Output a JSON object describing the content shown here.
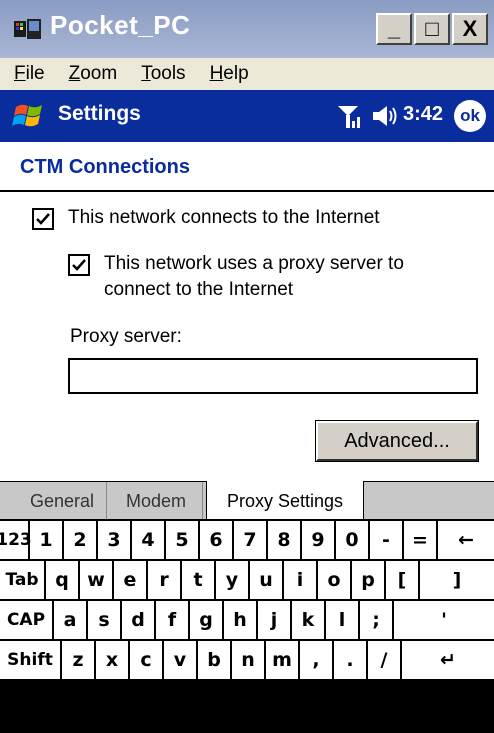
{
  "window": {
    "title": "Pocket_PC",
    "controls": {
      "minimize": "_",
      "maximize": "□",
      "close": "X"
    }
  },
  "menubar": {
    "items": [
      {
        "label_first": "F",
        "label_rest": "ile"
      },
      {
        "label_first": "Z",
        "label_rest": "oom"
      },
      {
        "label_first": "T",
        "label_rest": "ools"
      },
      {
        "label_first": "H",
        "label_rest": "elp"
      }
    ]
  },
  "navbar": {
    "title": "Settings",
    "time": "3:42",
    "ok_label": "ok",
    "icons": [
      "start-flag-icon",
      "signal-icon",
      "speaker-icon"
    ]
  },
  "page": {
    "title": "CTM Connections",
    "checkbox_internet": {
      "label": "This network connects to the Internet",
      "checked": true
    },
    "checkbox_proxy": {
      "label_line1": "This network uses a proxy server to",
      "label_line2": "connect to the Internet",
      "checked": true
    },
    "proxy_server_label": "Proxy server:",
    "proxy_server_value": "",
    "advanced_button": "Advanced..."
  },
  "tabs": [
    {
      "label": "General",
      "active": false
    },
    {
      "label": "Modem",
      "active": false
    },
    {
      "label": "Proxy Settings",
      "active": true
    }
  ],
  "keyboard": {
    "row1": [
      "123",
      "1",
      "2",
      "3",
      "4",
      "5",
      "6",
      "7",
      "8",
      "9",
      "0",
      "-",
      "=",
      "←"
    ],
    "row2": [
      "Tab",
      "q",
      "w",
      "e",
      "r",
      "t",
      "y",
      "u",
      "i",
      "o",
      "p",
      "[",
      "]"
    ],
    "row3": [
      "CAP",
      "a",
      "s",
      "d",
      "f",
      "g",
      "h",
      "j",
      "k",
      "l",
      ";",
      "'"
    ],
    "row4": [
      "Shift",
      "z",
      "x",
      "c",
      "v",
      "b",
      "n",
      "m",
      ",",
      ".",
      "/",
      "↵"
    ]
  },
  "colors": {
    "navbar": "#0a2d9e",
    "title_text": "#0a2d9e",
    "titlebar": "#8a9cc3"
  }
}
